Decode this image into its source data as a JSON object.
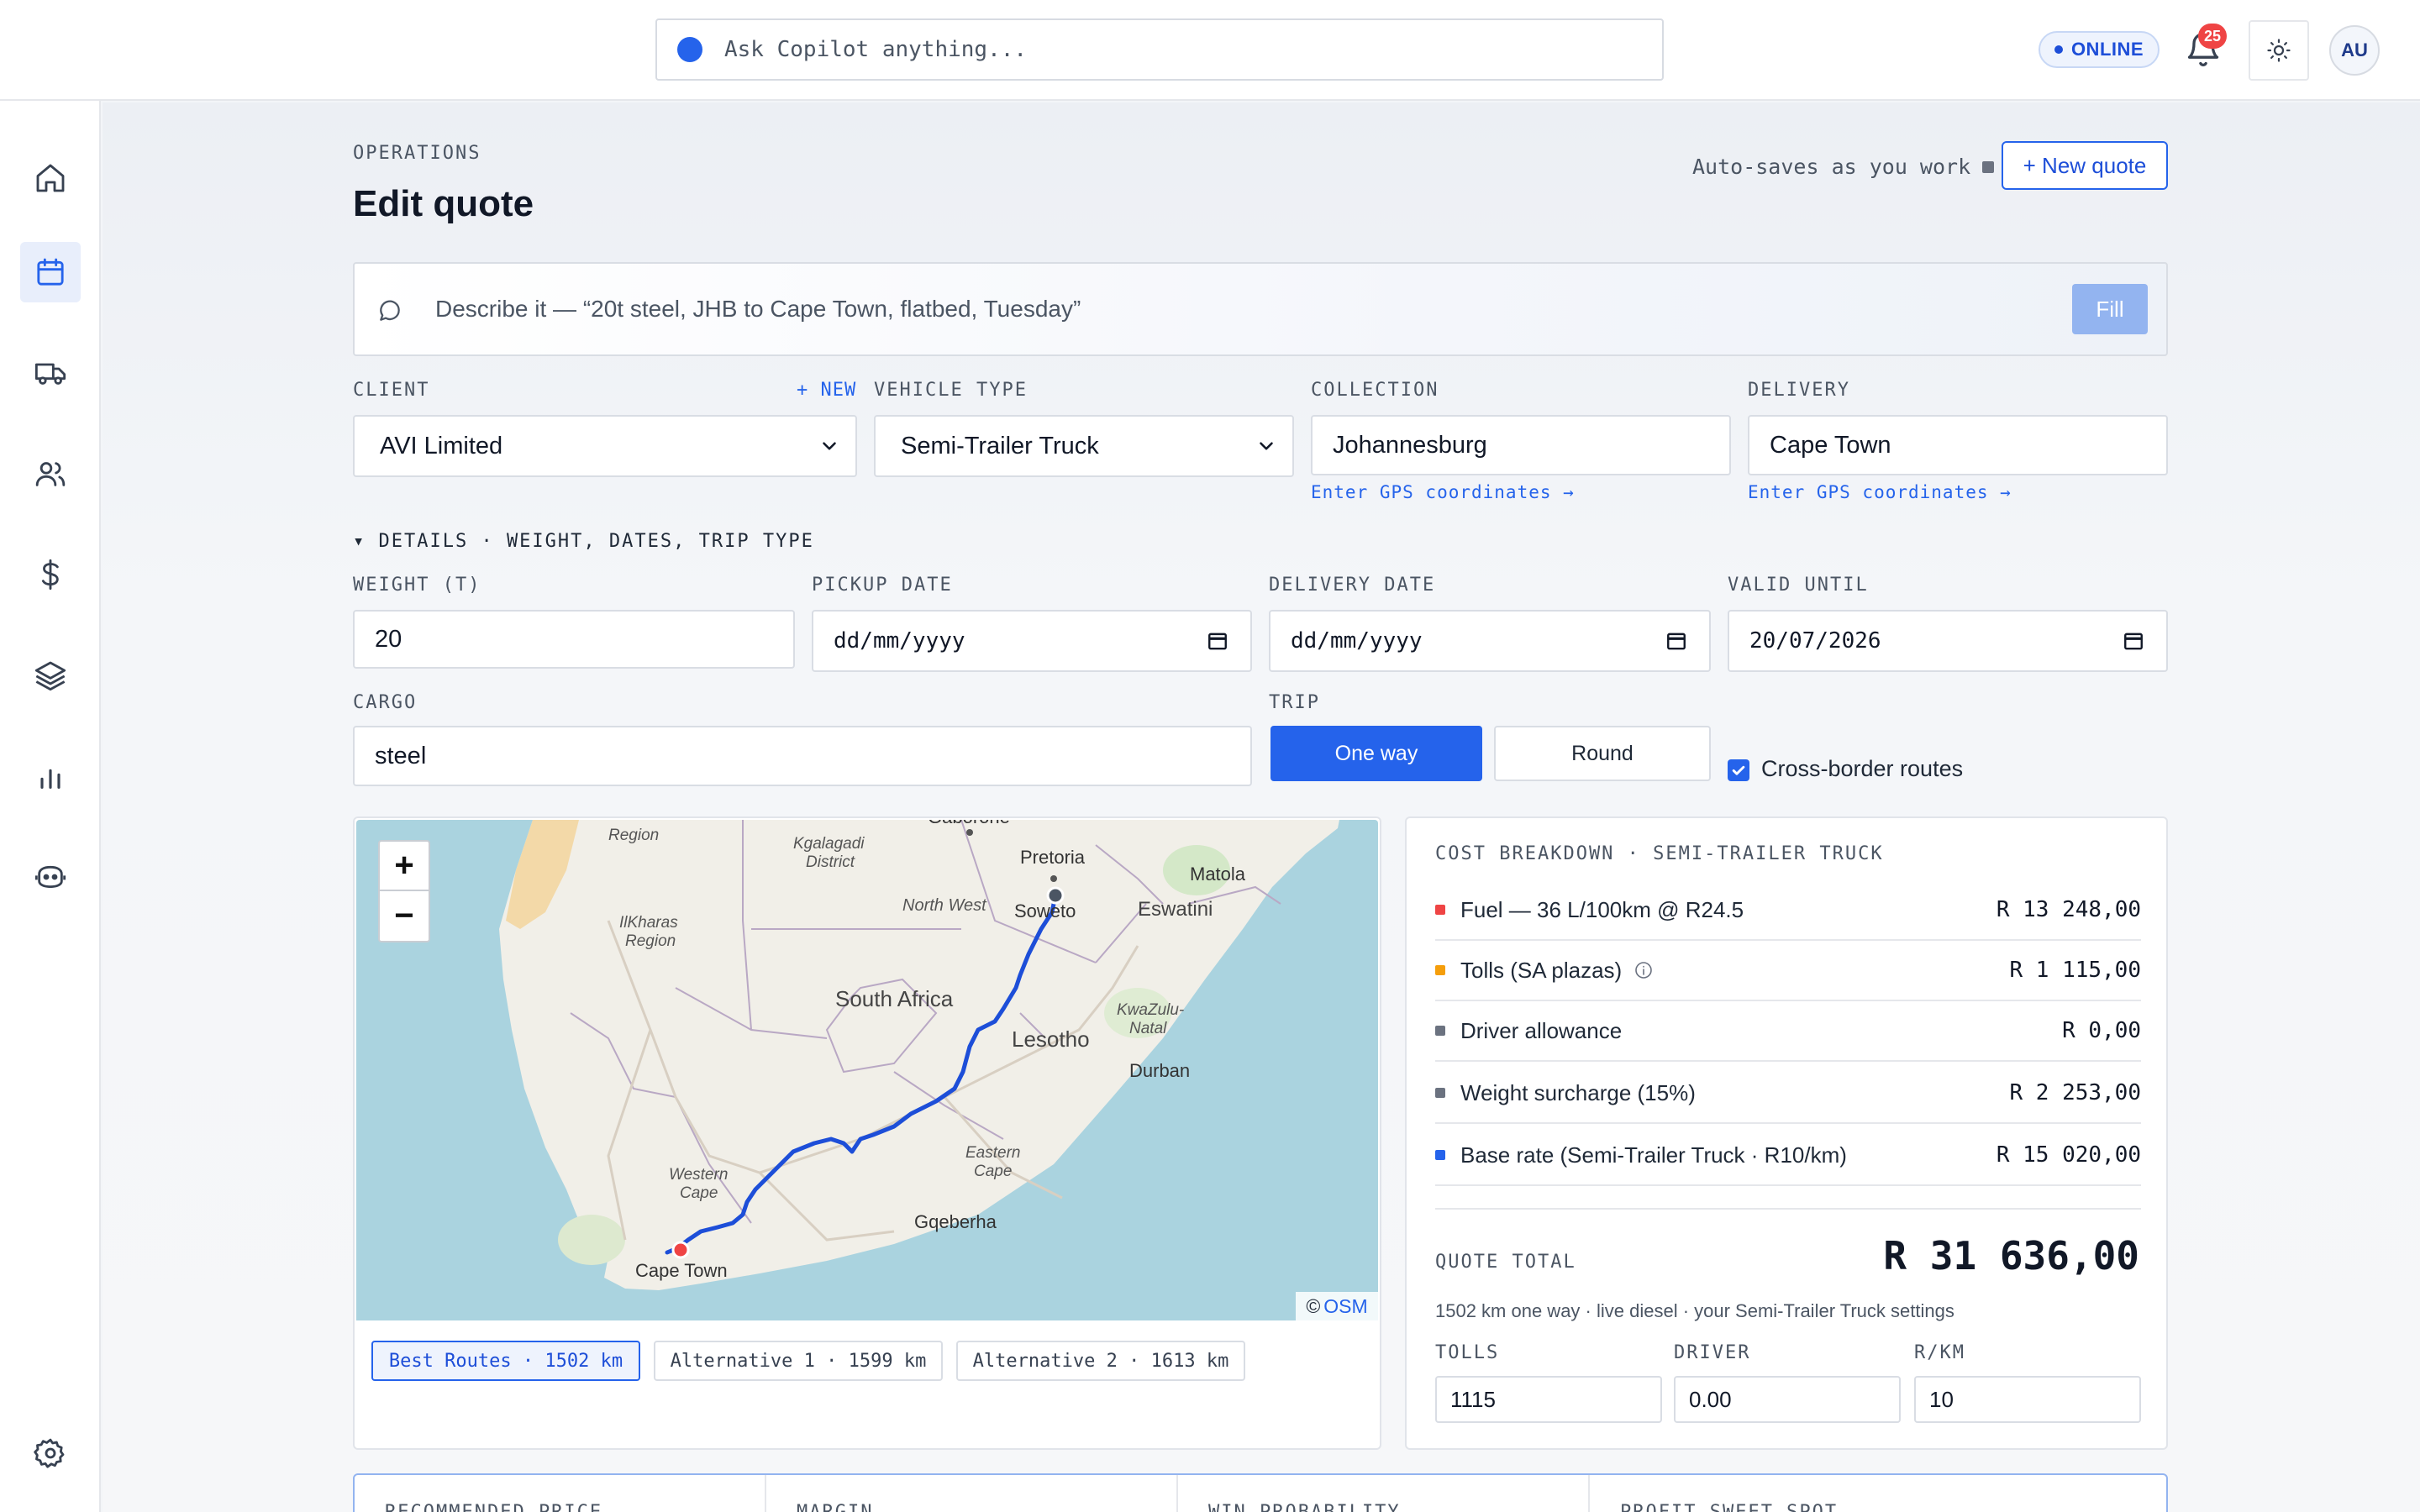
{
  "copilot": {
    "placeholder": "Ask Copilot anything..."
  },
  "status": {
    "online_label": "ONLINE",
    "notifications_count": "25",
    "user_initials": "AU"
  },
  "sidebar": {
    "items": [
      {
        "icon": "home-icon",
        "active": false
      },
      {
        "icon": "calendar-icon",
        "active": true
      },
      {
        "icon": "truck-icon",
        "active": false
      },
      {
        "icon": "users-icon",
        "active": false
      },
      {
        "icon": "dollar-icon",
        "active": false
      },
      {
        "icon": "layers-icon",
        "active": false
      },
      {
        "icon": "bar-chart-icon",
        "active": false
      },
      {
        "icon": "bot-icon",
        "active": false
      },
      {
        "icon": "settings-icon",
        "active": false
      }
    ]
  },
  "page": {
    "eyebrow": "OPERATIONS",
    "title": "Edit quote",
    "autosave": "Auto-saves as you work",
    "new_quote": "+ New quote"
  },
  "describe": {
    "placeholder": "Describe it — “20t steel, JHB to Cape Town, flatbed, Tuesday”",
    "fill": "Fill"
  },
  "form": {
    "client_label": "CLIENT",
    "client_new": "+ NEW",
    "client_value": "AVI Limited",
    "vehicle_label": "VEHICLE TYPE",
    "vehicle_value": "Semi-Trailer Truck",
    "collection_label": "COLLECTION",
    "collection_value": "Johannesburg",
    "delivery_label": "DELIVERY",
    "delivery_value": "Cape Town",
    "gps_link": "Enter GPS coordinates →",
    "details_toggle": "▾ DETAILS · WEIGHT, DATES, TRIP TYPE",
    "weight_label": "WEIGHT (T)",
    "weight_value": "20",
    "pickup_label": "PICKUP DATE",
    "pickup_value": "dd/mm/yyyy",
    "delivery_date_label": "DELIVERY DATE",
    "delivery_date_value": "dd/mm/yyyy",
    "valid_label": "VALID UNTIL",
    "valid_value": "20/07/2026",
    "cargo_label": "CARGO",
    "cargo_value": "steel",
    "trip_label": "TRIP",
    "trip_one_way": "One way",
    "trip_round": "Round",
    "cross_border": "Cross-border routes",
    "cross_border_checked": true
  },
  "map": {
    "attribution_prefix": "©",
    "attribution_link": "OSM",
    "labels": {
      "region_top": "Region",
      "kgalagadi": "Kgalagadi",
      "district": "District",
      "gaborone": "Gaborone",
      "pretoria": "Pretoria",
      "soweto": "Soweto",
      "matola": "Matola",
      "eswatini": "Eswatini",
      "north_west": "North West",
      "ilkharas": "IlKharas",
      "region": "Region",
      "south_africa": "South Africa",
      "lesotho": "Lesotho",
      "kwazulu": "KwaZulu-",
      "natal": "Natal",
      "durban": "Durban",
      "eastern": "Eastern",
      "cape": "Cape",
      "western": "Western",
      "gqeberha": "Gqeberha",
      "cape_town": "Cape Town"
    },
    "routes": [
      {
        "label": "Best Routes · 1502 km",
        "active": true
      },
      {
        "label": "Alternative 1 · 1599 km",
        "active": false
      },
      {
        "label": "Alternative 2 · 1613 km",
        "active": false
      }
    ]
  },
  "cost": {
    "title": "COST BREAKDOWN · SEMI-TRAILER TRUCK",
    "rows": [
      {
        "label": "Fuel — 36 L/100km @ R24.5",
        "amount": "R 13 248,00",
        "color": "#ef4444",
        "info": false
      },
      {
        "label": "Tolls (SA plazas)",
        "amount": "R 1 115,00",
        "color": "#f59e0b",
        "info": true
      },
      {
        "label": "Driver allowance",
        "amount": "R 0,00",
        "color": "#6b7280",
        "info": false
      },
      {
        "label": "Weight surcharge (15%)",
        "amount": "R 2 253,00",
        "color": "#6b7280",
        "info": false
      },
      {
        "label": "Base rate (Semi-Trailer Truck · R10/km)",
        "amount": "R 15 020,00",
        "color": "#2563eb",
        "info": false
      }
    ],
    "total_label": "QUOTE TOTAL",
    "total_value": "R 31 636,00",
    "note": "1502 km one way · live diesel · your Semi-Trailer Truck settings",
    "tolls_label": "TOLLS",
    "tolls_value": "1115",
    "driver_label": "DRIVER",
    "driver_value": "0.00",
    "rkm_label": "R/KM",
    "rkm_value": "10"
  },
  "stats": [
    {
      "label": "RECOMMENDED PRICE"
    },
    {
      "label": "MARGIN"
    },
    {
      "label": "WIN PROBABILITY"
    },
    {
      "label": "PROFIT SWEET SPOT"
    }
  ]
}
